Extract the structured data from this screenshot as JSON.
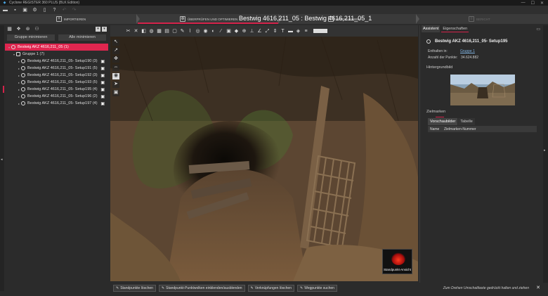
{
  "app": {
    "title": "Cyclone REGISTER 360 PLUS (BLK Edition)"
  },
  "window_controls": {
    "minimize": "—",
    "maximize": "☐",
    "close": "✕"
  },
  "steps": [
    {
      "label": "IMPORTIEREN"
    },
    {
      "label": "ÜBERPRÜFEN UND OPTIMIEREN"
    },
    {
      "label": "ABSCHLIESSEN"
    },
    {
      "label": "BERICHT"
    }
  ],
  "scan_title": "Bestwig 4616,211_05 : Bestwig 4616,211_05_1",
  "left_panel": {
    "group_min_button": "Gruppe minimieren",
    "all_min_button": "Alle minimieren",
    "tree": [
      {
        "label": "Bestwig AKZ 4616,211_05 (1)",
        "level": 0,
        "selected": true
      },
      {
        "label": "Gruppe 1 (7)",
        "level": 1
      },
      {
        "label": "Bestwig AKZ 4616,211_05- Setup190 (3)",
        "level": 2
      },
      {
        "label": "Bestwig AKZ 4616,211_05- Setup191 (5)",
        "level": 2
      },
      {
        "label": "Bestwig AKZ 4616,211_05- Setup192 (3)",
        "level": 2
      },
      {
        "label": "Bestwig AKZ 4616,211_05- Setup193 (5)",
        "level": 2
      },
      {
        "label": "Bestwig AKZ 4616,211_05- Setup195 (4)",
        "level": 2,
        "marked": true
      },
      {
        "label": "Bestwig AKZ 4616,211_05- Setup196 (2)",
        "level": 2
      },
      {
        "label": "Bestwig AKZ 4616,211_05- Setup197 (4)",
        "level": 2
      }
    ]
  },
  "viewer": {
    "standpunkt_label": "Standpunkt-Ansicht"
  },
  "bottom_bar": {
    "buttons": [
      "Standpunkte löschen",
      "Standpunkt-Punktwolken einblenden/ausblenden",
      "Verknüpfungen löschen",
      "Wegpunkte suchen"
    ],
    "hint": "Zum Drehen Umschalttaste gedrückt halten und ziehen"
  },
  "right_panel": {
    "tabs": [
      "Assistent",
      "Eigenschaften"
    ],
    "title": "Bestwig AKZ 4616,211_05- Setup195",
    "contained_label": "Enthalten in:",
    "contained_value": "Gruppe 1",
    "points_label": "Anzahl der Punkte:",
    "points_value": "34.624.882",
    "background_label": "Hintergrundbild",
    "targets_label": "Zielmarken",
    "sub_tabs": [
      "Vorschaubilder",
      "Tabelle"
    ],
    "table_headers": [
      "Name",
      "Zielmarken-Nummer"
    ]
  },
  "colors": {
    "accent": "#d4224b",
    "selected_row": "#e0264f",
    "link": "#7fb2e0"
  }
}
